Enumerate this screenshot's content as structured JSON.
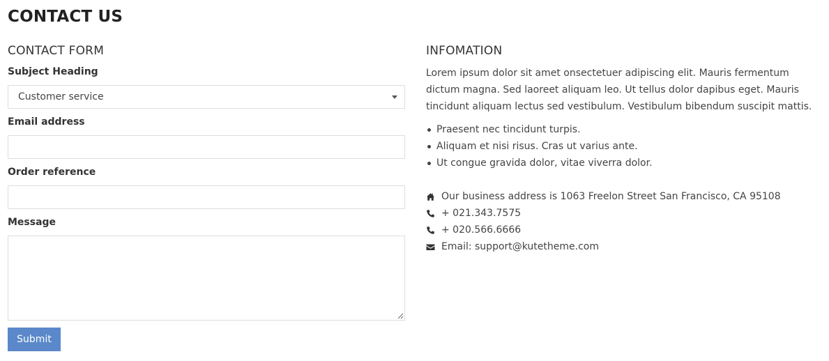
{
  "page": {
    "title": "CONTACT US"
  },
  "form": {
    "section_title": "CONTACT FORM",
    "subject_label": "Subject Heading",
    "subject_value": "Customer service",
    "email_label": "Email address",
    "email_value": "",
    "order_label": "Order reference",
    "order_value": "",
    "message_label": "Message",
    "message_value": "",
    "submit_label": "Submit"
  },
  "info": {
    "section_title": "INFOMATION",
    "paragraph": "Lorem ipsum dolor sit amet onsectetuer adipiscing elit. Mauris fermentum dictum magna. Sed laoreet aliquam leo. Ut tellus dolor dapibus eget. Mauris tincidunt aliquam lectus sed vestibulum. Vestibulum bibendum suscipit mattis.",
    "bullets": [
      "Praesent nec tincidunt turpis.",
      "Aliquam et nisi risus. Cras ut varius ante.",
      "Ut congue gravida dolor, vitae viverra dolor."
    ],
    "contacts": [
      {
        "icon": "home-icon",
        "text": "Our business address is 1063 Freelon Street San Francisco, CA 95108"
      },
      {
        "icon": "phone-icon",
        "text": "+ 021.343.7575"
      },
      {
        "icon": "phone-icon",
        "text": "+ 020.566.6666"
      },
      {
        "icon": "envelope-icon",
        "text": "Email: support@kutetheme.com"
      }
    ]
  },
  "colors": {
    "accent": "#5a88ca",
    "border": "#dddddd",
    "text": "#444444"
  }
}
